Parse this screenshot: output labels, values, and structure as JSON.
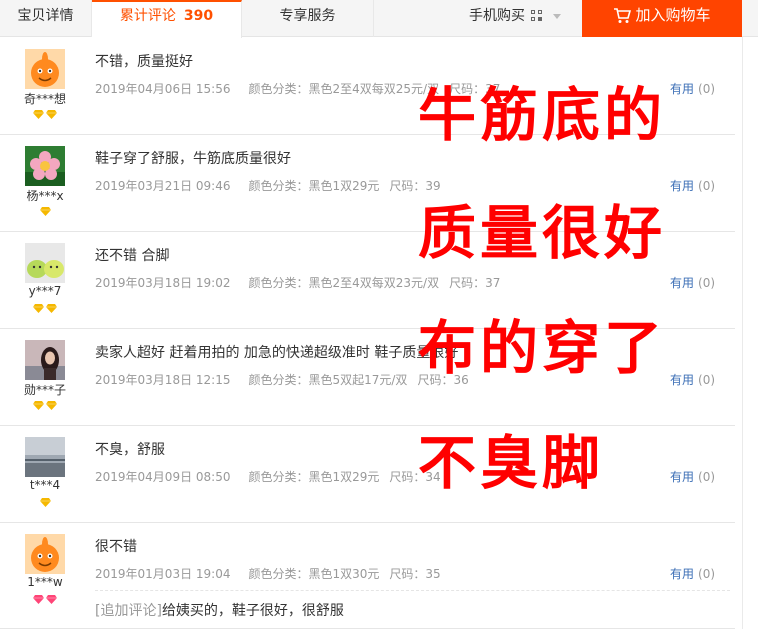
{
  "tabs": {
    "details": "宝贝详情",
    "reviews": "累计评论",
    "review_count": "390",
    "service": "专享服务"
  },
  "mobile_buy": {
    "label": "手机购买"
  },
  "cart": {
    "label": "加入购物车"
  },
  "reviews": [
    {
      "content": "不错，质量挺好",
      "date": "2019年04月06日 15:56",
      "sku": "颜色分类：黑色2至4双每双25元/双",
      "size": "尺码：37",
      "user": "奇***想",
      "useful": "有用",
      "useful_count": "(0)",
      "rank_color": "#f5b800",
      "avatar": "orange-mascot"
    },
    {
      "content": "鞋子穿了舒服，牛筋底质量很好",
      "date": "2019年03月21日 09:46",
      "sku": "颜色分类：黑色1双29元",
      "size": "尺码：39",
      "user": "杨***x",
      "useful": "有用",
      "useful_count": "(0)",
      "rank_color": "#f5b800",
      "avatar": "flower"
    },
    {
      "content": "还不错 合脚",
      "date": "2019年03月18日 19:02",
      "sku": "颜色分类：黑色2至4双每双23元/双",
      "size": "尺码：37",
      "user": "y***7",
      "useful": "有用",
      "useful_count": "(0)",
      "rank_color": "#f5b800",
      "avatar": "green-characters"
    },
    {
      "content": "卖家人超好 赶着用拍的 加急的快递超级准时 鞋子质量很好",
      "date": "2019年03月18日 12:15",
      "sku": "颜色分类：黑色5双起17元/双",
      "size": "尺码：36",
      "user": "勋***子",
      "useful": "有用",
      "useful_count": "(0)",
      "rank_color": "#f5b800",
      "avatar": "girl-photo"
    },
    {
      "content": "不臭，舒服",
      "date": "2019年04月09日 08:50",
      "sku": "颜色分类：黑色1双29元",
      "size": "尺码：34",
      "user": "t***4",
      "useful": "有用",
      "useful_count": "(0)",
      "rank_color": "#f5b800",
      "avatar": "sky-photo"
    },
    {
      "content": "很不错",
      "date": "2019年01月03日 19:04",
      "sku": "颜色分类：黑色1双30元",
      "size": "尺码：35",
      "user": "1***w",
      "useful": "有用",
      "useful_count": "(0)",
      "rank_color": "#ff4477",
      "avatar": "orange-mascot",
      "append_tag": "[追加评论]",
      "append_text": "给姨买的，鞋子很好，很舒服"
    }
  ],
  "overlay": {
    "line1": "牛筋底的",
    "line2": "质量很好",
    "line3": "布的穿了",
    "line4": "不臭脚"
  }
}
